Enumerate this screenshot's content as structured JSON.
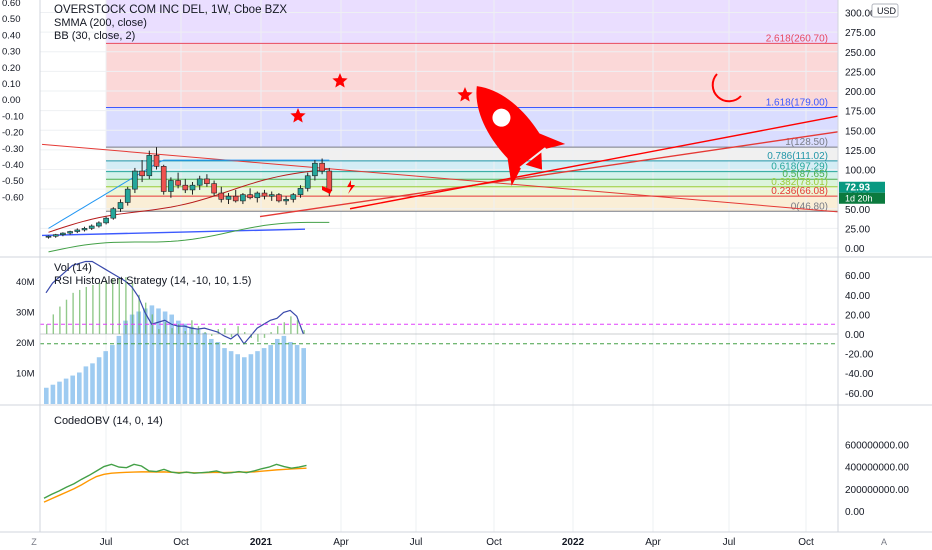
{
  "chart_data": {
    "type": "candlestick",
    "symbol_title": "OVERSTOCK COM INC DEL, 1W, Cboe BZX",
    "indicators": {
      "main": [
        "SMMA (200, close)",
        "BB (30, close, 2)"
      ],
      "pane2": [
        "Vol (14)",
        "RSI HistoAlert Strategy (14, -10, 10, 1.5)"
      ],
      "pane3": [
        "CodedOBV (14, 0, 14)"
      ]
    },
    "currency": "USD",
    "price_axis": {
      "ticks": [
        "300.00",
        "275.00",
        "250.00",
        "225.00",
        "200.00",
        "175.00",
        "150.00",
        "125.00",
        "100.00",
        "75.00",
        "50.00",
        "25.00",
        "0.00"
      ],
      "range": [
        -20,
        310
      ]
    },
    "left_axis": {
      "ticks": [
        "0.60",
        "0.50",
        "0.40",
        "0.30",
        "0.20",
        "0.10",
        "0.00",
        "-0.10",
        "-0.20",
        "-0.30",
        "-0.40",
        "-0.50",
        "-0.60"
      ]
    },
    "time_axis": [
      "Jul",
      "Oct",
      "2021",
      "Apr",
      "Jul",
      "Oct",
      "2022",
      "Apr",
      "Jul",
      "Oct"
    ],
    "fib_levels": [
      {
        "label": "2.618(260.70)",
        "price": 260.7,
        "color": "#e84a5f"
      },
      {
        "label": "1.618(179.00)",
        "price": 179.0,
        "color": "#3d5afe"
      },
      {
        "label": "1(128.50)",
        "price": 128.5,
        "color": "#787b86"
      },
      {
        "label": "0.786(111.02)",
        "price": 111.02,
        "color": "#2196a8"
      },
      {
        "label": "0.618(97.29)",
        "price": 97.29,
        "color": "#26a69a"
      },
      {
        "label": "0.5(87.65)",
        "price": 87.65,
        "color": "#4caf50"
      },
      {
        "label": "0.382(78.01)",
        "price": 78.01,
        "color": "#9ccc3c"
      },
      {
        "label": "0.236(66.08)",
        "price": 66.08,
        "color": "#e53935"
      },
      {
        "label": "0(46.80)",
        "price": 46.8,
        "color": "#787b86"
      }
    ],
    "last_price": {
      "value": "72.93",
      "countdown": "1d 20h"
    },
    "candles": [
      {
        "o": 14,
        "h": 16,
        "l": 12,
        "c": 15
      },
      {
        "o": 15,
        "h": 18,
        "l": 13,
        "c": 17
      },
      {
        "o": 17,
        "h": 20,
        "l": 15,
        "c": 19
      },
      {
        "o": 19,
        "h": 22,
        "l": 17,
        "c": 21
      },
      {
        "o": 21,
        "h": 25,
        "l": 19,
        "c": 23
      },
      {
        "o": 23,
        "h": 27,
        "l": 21,
        "c": 25
      },
      {
        "o": 25,
        "h": 30,
        "l": 23,
        "c": 28
      },
      {
        "o": 28,
        "h": 34,
        "l": 26,
        "c": 32
      },
      {
        "o": 32,
        "h": 40,
        "l": 30,
        "c": 38
      },
      {
        "o": 38,
        "h": 52,
        "l": 36,
        "c": 50
      },
      {
        "o": 50,
        "h": 62,
        "l": 46,
        "c": 58
      },
      {
        "o": 58,
        "h": 78,
        "l": 54,
        "c": 75
      },
      {
        "o": 75,
        "h": 102,
        "l": 70,
        "c": 98
      },
      {
        "o": 98,
        "h": 112,
        "l": 84,
        "c": 92
      },
      {
        "o": 92,
        "h": 124,
        "l": 88,
        "c": 118
      },
      {
        "o": 118,
        "h": 128.5,
        "l": 100,
        "c": 104
      },
      {
        "o": 104,
        "h": 106,
        "l": 68,
        "c": 72
      },
      {
        "o": 72,
        "h": 90,
        "l": 64,
        "c": 86
      },
      {
        "o": 86,
        "h": 96,
        "l": 76,
        "c": 80
      },
      {
        "o": 80,
        "h": 88,
        "l": 70,
        "c": 74
      },
      {
        "o": 74,
        "h": 84,
        "l": 68,
        "c": 80
      },
      {
        "o": 80,
        "h": 92,
        "l": 74,
        "c": 88
      },
      {
        "o": 88,
        "h": 94,
        "l": 78,
        "c": 82
      },
      {
        "o": 82,
        "h": 86,
        "l": 66,
        "c": 70
      },
      {
        "o": 70,
        "h": 78,
        "l": 58,
        "c": 62
      },
      {
        "o": 62,
        "h": 70,
        "l": 56,
        "c": 66
      },
      {
        "o": 66,
        "h": 74,
        "l": 58,
        "c": 60
      },
      {
        "o": 60,
        "h": 70,
        "l": 56,
        "c": 68
      },
      {
        "o": 68,
        "h": 76,
        "l": 62,
        "c": 64
      },
      {
        "o": 64,
        "h": 72,
        "l": 58,
        "c": 70
      },
      {
        "o": 70,
        "h": 74,
        "l": 62,
        "c": 66
      },
      {
        "o": 66,
        "h": 72,
        "l": 60,
        "c": 68
      },
      {
        "o": 68,
        "h": 70,
        "l": 58,
        "c": 60
      },
      {
        "o": 60,
        "h": 66,
        "l": 55,
        "c": 62
      },
      {
        "o": 62,
        "h": 70,
        "l": 58,
        "c": 68
      },
      {
        "o": 68,
        "h": 80,
        "l": 64,
        "c": 76
      },
      {
        "o": 76,
        "h": 96,
        "l": 72,
        "c": 92
      },
      {
        "o": 92,
        "h": 112,
        "l": 86,
        "c": 108
      },
      {
        "o": 108,
        "h": 114,
        "l": 94,
        "c": 98
      },
      {
        "o": 98,
        "h": 102,
        "l": 66,
        "c": 72.93
      }
    ],
    "volume_ticks": [
      "40M",
      "30M",
      "20M",
      "10M"
    ],
    "volume_values_m": [
      5,
      6,
      7,
      8,
      9,
      10,
      12,
      13,
      15,
      17,
      19,
      22,
      27,
      29,
      30,
      31,
      32,
      31,
      30,
      29,
      27,
      26,
      25,
      24,
      23,
      21,
      20,
      18,
      17,
      16,
      15,
      16,
      17,
      18,
      19,
      21,
      22,
      20,
      19,
      18
    ],
    "rsi_ticks": [
      "60.00",
      "40.00",
      "20.00",
      "0.00",
      "-20.00",
      "-40.00",
      "-60.00"
    ],
    "rsi_histogram": [
      10,
      20,
      28,
      35,
      42,
      45,
      48,
      50,
      52,
      55,
      56,
      58,
      58,
      52,
      40,
      32,
      20,
      5,
      12,
      6,
      10,
      3,
      14,
      8,
      2,
      -2,
      5,
      6,
      -3,
      8,
      2,
      -4,
      -8,
      -4,
      2,
      8,
      12,
      18,
      14,
      4
    ],
    "rsi_line": [
      42,
      52,
      58,
      64,
      70,
      72,
      74,
      74,
      70,
      66,
      62,
      58,
      54,
      48,
      38,
      22,
      10,
      12,
      14,
      10,
      8,
      8,
      6,
      5,
      6,
      4,
      2,
      -2,
      -5,
      0,
      -10,
      -2,
      6,
      10,
      14,
      16,
      22,
      24,
      18,
      0
    ],
    "rsi_bands": [
      10,
      -10
    ],
    "obv_ticks": [
      "600000000.00",
      "400000000.00",
      "200000000.00",
      "0.00"
    ],
    "obv_line": [
      115,
      150,
      180,
      215,
      245,
      285,
      320,
      360,
      400,
      420,
      395,
      390,
      420,
      405,
      360,
      355,
      375,
      350,
      340,
      350,
      340,
      345,
      350,
      360,
      340,
      345,
      355,
      345,
      360,
      380,
      395,
      420,
      400,
      385,
      395,
      410
    ],
    "obv_signal": [
      80,
      110,
      140,
      170,
      200,
      235,
      275,
      310,
      330,
      340,
      345,
      348,
      350,
      352,
      352,
      350,
      352,
      348,
      346,
      348,
      344,
      344,
      346,
      348,
      346,
      348,
      350,
      350,
      352,
      358,
      364,
      370,
      374,
      378,
      382,
      385
    ],
    "colors": {
      "bull": "#26a69a",
      "bear": "#ef5350",
      "accent": "#ff0000",
      "trend_blue": "#3d5afe",
      "obv": "#43a047",
      "obv_signal": "#ff9800"
    }
  },
  "corner_labels": {
    "left": "Z",
    "right": "A"
  },
  "icons": {
    "rocket": "rocket-icon",
    "stars": "star-icon",
    "moon": "moon-icon",
    "lightning": "lightning-icon"
  }
}
